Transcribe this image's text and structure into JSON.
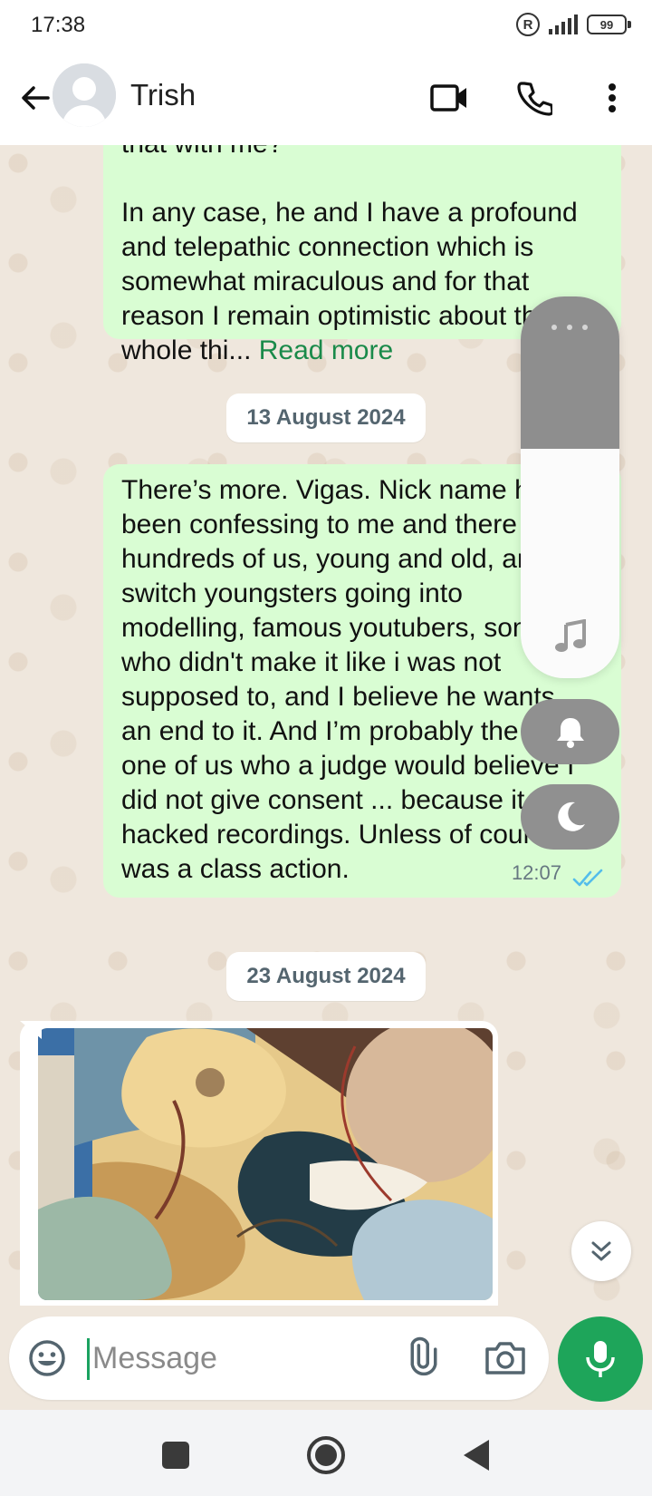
{
  "status_bar": {
    "time": "17:38",
    "registered_mark": "R",
    "battery": "99"
  },
  "header": {
    "contact_name": "Trish",
    "icons": [
      "back-arrow-icon",
      "avatar",
      "video-call-icon",
      "voice-call-icon",
      "more-options-icon"
    ]
  },
  "messages": [
    {
      "partial_top": "that with me?",
      "text": "In any case, he and I have a profound and telepathic connection which is somewhat miraculous and for that reason I remain optimistic about the whole thi...",
      "read_more": "Read more"
    },
    {
      "text": "There’s more. Vigas. Nick name has been confessing to me and there are hundreds of us, young and old, and switch youngsters going into modelling, famous youtubers, some who didn't make it like i was not supposed to, and I believe he wants an end to it. And I’m probably the only one of us who a judge would believe I did not give consent ... because it was hacked recordings. Unless of course it was a class action.",
      "time": "12:07",
      "status": "read"
    }
  ],
  "date_chips": {
    "first": "13 August 2024",
    "second": "23 August 2024"
  },
  "composer": {
    "placeholder": "Message"
  },
  "colors": {
    "outgoing_bubble": "#d9fdd3",
    "accent_green": "#1ea55a",
    "read_ticks": "#53bdeb",
    "chat_background": "#efe7dd"
  },
  "overlay": {
    "volume_level": 0.6,
    "icons": [
      "more-icon",
      "music-note-icon",
      "bell-icon",
      "moon-icon"
    ]
  }
}
